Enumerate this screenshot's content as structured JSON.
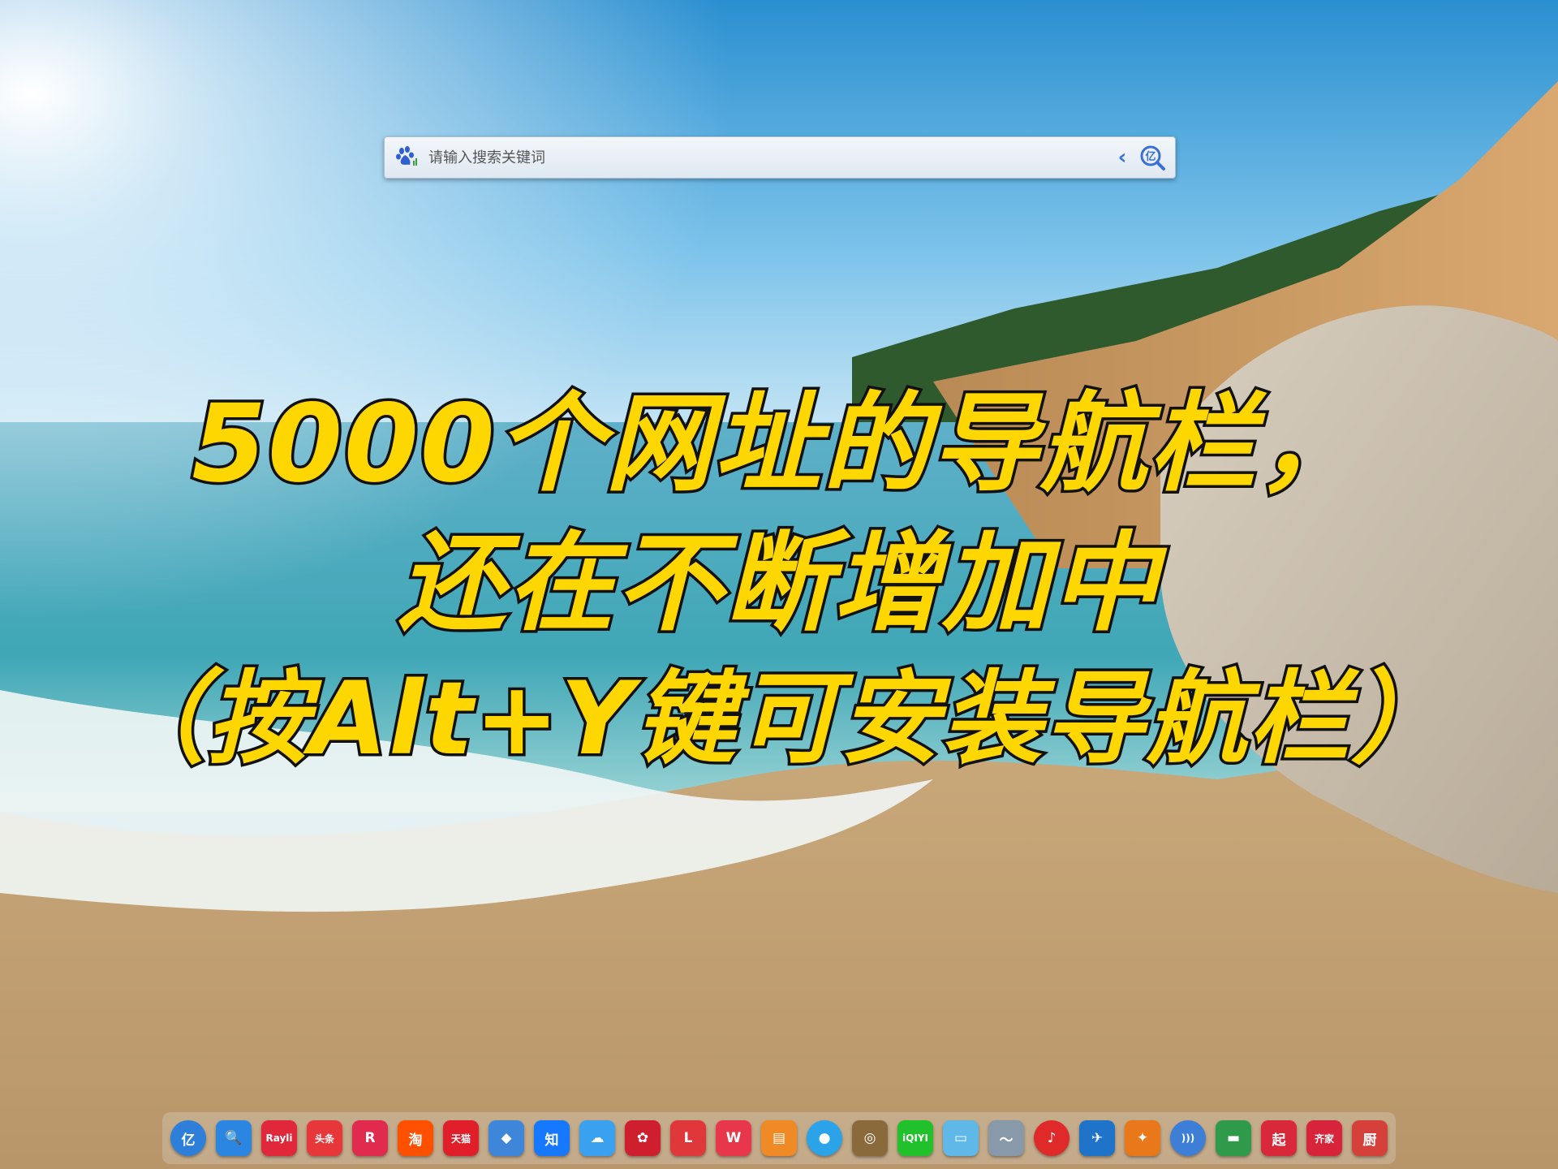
{
  "search": {
    "placeholder": "请输入搜索关键词",
    "engine_icon": "baidu-paw-icon",
    "back_icon": "chevron-left-icon",
    "go_icon": "yi-search-icon",
    "go_label": "亿"
  },
  "caption": {
    "line1": "5000个网址的导航栏，",
    "line2": "还在不断增加中",
    "line3": "（按Alt+Y键可安装导航栏）"
  },
  "dock": {
    "items": [
      {
        "name": "yi-nav-icon",
        "label": "亿",
        "color": "#2e7fd9",
        "round": true
      },
      {
        "name": "search-icon",
        "label": "🔍",
        "color": "#2a86e0"
      },
      {
        "name": "rayli-icon",
        "label": "Rayli",
        "color": "#e0283a",
        "small": true
      },
      {
        "name": "toutiao-icon",
        "label": "头条",
        "color": "#e8373a",
        "small": true
      },
      {
        "name": "r-app-icon",
        "label": "R",
        "color": "#e02a4e"
      },
      {
        "name": "taobao-icon",
        "label": "淘",
        "color": "#ff5000"
      },
      {
        "name": "tmall-icon",
        "label": "天猫",
        "color": "#e01f2b",
        "small": true
      },
      {
        "name": "cube-app-icon",
        "label": "◆",
        "color": "#3e86d9"
      },
      {
        "name": "zhihu-icon",
        "label": "知",
        "color": "#1677ff"
      },
      {
        "name": "baidu-netdisk-icon",
        "label": "☁",
        "color": "#3aa1f0"
      },
      {
        "name": "huawei-icon",
        "label": "✿",
        "color": "#cf1f2e"
      },
      {
        "name": "l-app-icon",
        "label": "L",
        "color": "#e0383a"
      },
      {
        "name": "wps-icon",
        "label": "W",
        "color": "#e8374a"
      },
      {
        "name": "flag-app-icon",
        "label": "▤",
        "color": "#f08a24"
      },
      {
        "name": "qq-icon",
        "label": "●",
        "color": "#2aa3e8",
        "round": true
      },
      {
        "name": "game-app-icon",
        "label": "◎",
        "color": "#8a6a3a"
      },
      {
        "name": "iqiyi-icon",
        "label": "iQIYI",
        "color": "#21c12c",
        "small": true
      },
      {
        "name": "chat-app-icon",
        "label": "▭",
        "color": "#5fb8e8"
      },
      {
        "name": "dolphin-app-icon",
        "label": "〜",
        "color": "#8899aa"
      },
      {
        "name": "netease-music-icon",
        "label": "♪",
        "color": "#e02a2a",
        "round": true
      },
      {
        "name": "bird-app-icon",
        "label": "✈",
        "color": "#1f74c9"
      },
      {
        "name": "badge-app-icon",
        "label": "✦",
        "color": "#e8781a"
      },
      {
        "name": "rss-icon",
        "label": ")))",
        "color": "#3d7fd6",
        "round": true,
        "small": true
      },
      {
        "name": "green-app-icon",
        "label": "▬",
        "color": "#2e9a4a"
      },
      {
        "name": "qidian-icon",
        "label": "起",
        "color": "#d8283a"
      },
      {
        "name": "qijia-icon",
        "label": "齐家",
        "color": "#d8243a",
        "small": true
      },
      {
        "name": "chef-app-icon",
        "label": "厨",
        "color": "#d6403a"
      }
    ]
  }
}
